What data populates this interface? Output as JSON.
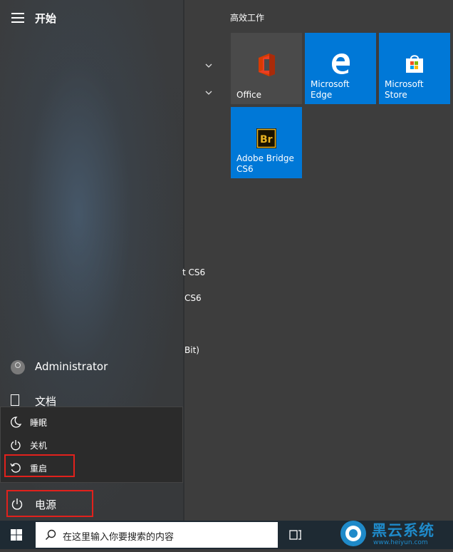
{
  "start": {
    "title": "开始"
  },
  "app_list_partial": [
    {
      "text": "t CS6"
    },
    {
      "text": "CS6"
    },
    {
      "text": "Bit)"
    }
  ],
  "tiles": {
    "group_title": "高效工作",
    "items": [
      {
        "label": "Office",
        "bg": "#4a4a4a",
        "icon": "office-icon"
      },
      {
        "label": "Microsoft Edge",
        "bg": "#0078d7",
        "icon": "edge-icon"
      },
      {
        "label": "Microsoft Store",
        "bg": "#0078d7",
        "icon": "store-icon"
      },
      {
        "label": "Adobe Bridge CS6",
        "bg": "#0078d7",
        "icon": "bridge-icon"
      }
    ]
  },
  "user": {
    "name": "Administrator"
  },
  "places": {
    "documents": "文档"
  },
  "power_menu": {
    "items": [
      {
        "label": "睡眠",
        "icon": "moon-icon"
      },
      {
        "label": "关机",
        "icon": "power-icon"
      },
      {
        "label": "重启",
        "icon": "restart-icon"
      }
    ]
  },
  "power": {
    "label": "电源"
  },
  "taskbar": {
    "search_placeholder": "在这里输入你要搜索的内容"
  },
  "watermark": {
    "text": "黑云系统",
    "sub": "www.heiyun.com"
  },
  "colors": {
    "accent": "#0078d7",
    "highlight": "#e2211c",
    "taskbar": "#1e2a33"
  }
}
